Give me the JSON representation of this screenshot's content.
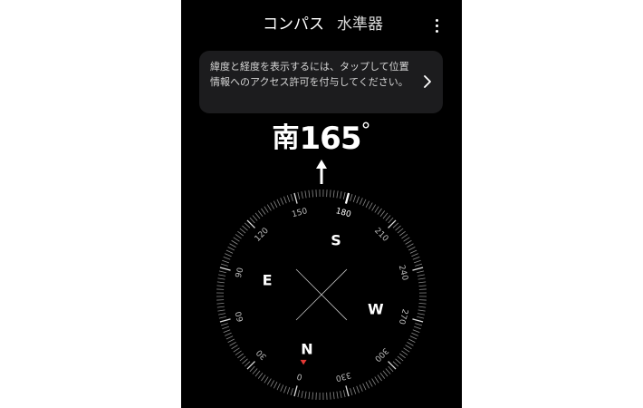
{
  "tabs": [
    {
      "label": "コンパス",
      "active": true
    },
    {
      "label": "水準器",
      "active": false
    }
  ],
  "more_icon": "vertical-ellipsis-icon",
  "banner": {
    "text": "緯度と経度を表示するには、タップして位置情報へのアクセス許可を付与してください。",
    "chevron_icon": "chevron-right-icon"
  },
  "heading": {
    "direction": "南",
    "degrees": "165",
    "symbol": "°"
  },
  "compass": {
    "rotation_deg": 165,
    "cardinals": [
      {
        "label": "N",
        "bearing": 0
      },
      {
        "label": "E",
        "bearing": 90
      },
      {
        "label": "S",
        "bearing": 180
      },
      {
        "label": "W",
        "bearing": 270
      }
    ],
    "degree_labels": [
      "0",
      "30",
      "60",
      "90",
      "120",
      "150",
      "180",
      "210",
      "240",
      "270",
      "300",
      "330"
    ],
    "north_marker_color": "#e53935",
    "pointer_icon": "up-arrow-icon"
  },
  "colors": {
    "background": "#000000",
    "text": "#ffffff",
    "banner_bg": "#1c1c1e",
    "north_marker": "#e53935"
  }
}
